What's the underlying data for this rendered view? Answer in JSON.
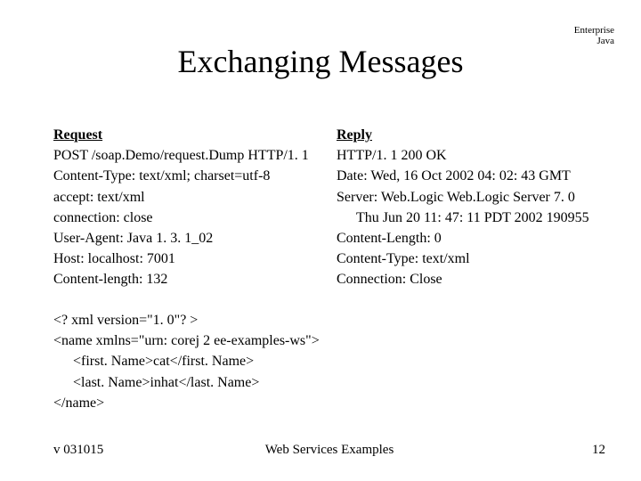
{
  "corner": {
    "line1": "Enterprise",
    "line2": "Java"
  },
  "title": "Exchanging Messages",
  "request": {
    "heading": "Request",
    "lines": [
      "POST /soap.Demo/request.Dump HTTP/1. 1",
      "Content-Type: text/xml; charset=utf-8",
      "accept: text/xml",
      "connection: close",
      "User-Agent: Java 1. 3. 1_02",
      "Host: localhost: 7001",
      "Content-length: 132"
    ]
  },
  "reply": {
    "heading": "Reply",
    "lines": [
      "HTTP/1. 1 200 OK",
      "Date: Wed, 16 Oct 2002 04: 02: 43 GMT",
      "Server: Web.Logic Web.Logic Server 7. 0",
      "Thu Jun 20 11: 47: 11 PDT 2002 190955",
      "Content-Length: 0",
      "Content-Type: text/xml",
      "Connection: Close"
    ]
  },
  "xml": {
    "l1": "<? xml version=\"1. 0\"? >",
    "l2": "<name xmlns=\"urn: corej 2 ee-examples-ws\">",
    "l3": "<first. Name>cat</first. Name>",
    "l4": "<last. Name>inhat</last. Name>",
    "l5": "</name>"
  },
  "footer": {
    "left": "v 031015",
    "center": "Web Services Examples",
    "right": "12"
  }
}
